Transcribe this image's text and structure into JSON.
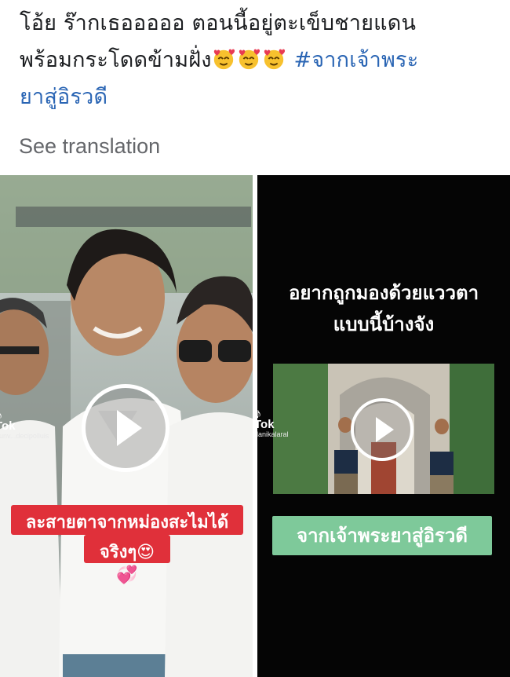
{
  "post": {
    "line1": "โอ้ย ร๊ากเธอออออ ตอนนี้อยู่ตะเข็บชายแดน",
    "line2": "พร้อมกระโดดข้ามฝั่ง",
    "hashtag_part1": "#จากเจ้าพระ",
    "hashtag_part2": "ยาสู่อิรวดี",
    "emojis": [
      "smiling-face-with-hearts",
      "smiling-face-with-hearts",
      "smiling-face-with-hearts"
    ]
  },
  "see_translation": "See translation",
  "videos": [
    {
      "watermark": "TikTok",
      "watermark_visible": "Tok",
      "username": "ounv...decipolluis",
      "caption_line1": "ละสายตาจากหม่องสะไมได้เลย",
      "caption_line2": "จริงๆ😍💞"
    },
    {
      "watermark": "TikTok",
      "watermark_visible": "Tok",
      "username": "danikalaral",
      "title_line1": "อยากถูกมองด้วยแววตา",
      "title_line2": "แบบนี้บ้างจัง",
      "caption": "จากเจ้าพระยาสู่อิรวดี"
    }
  ],
  "colors": {
    "hashtag": "#2a65b4",
    "caption_red": "#e0303a",
    "caption_green": "#7ec99a",
    "secondary_text": "#65676b"
  }
}
